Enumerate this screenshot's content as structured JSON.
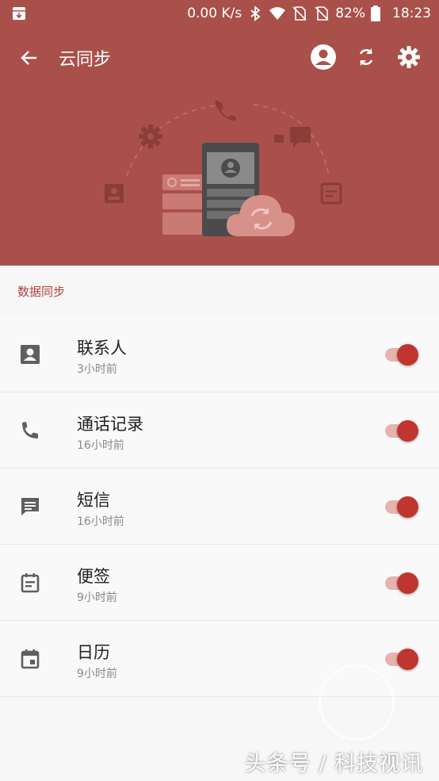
{
  "status_bar": {
    "network_speed": "0.00 K/s",
    "battery": "82%",
    "time": "18:23",
    "icons": [
      "download-icon",
      "bluetooth-icon",
      "wifi-icon",
      "sim-off-icon",
      "sim-off-icon",
      "battery-icon"
    ]
  },
  "toolbar": {
    "title": "云同步",
    "icons": [
      "back-arrow-icon",
      "account-icon",
      "sync-icon",
      "settings-icon"
    ]
  },
  "section": {
    "title": "数据同步"
  },
  "items": [
    {
      "label": "联系人",
      "sub": "3小时前",
      "icon": "contact-icon",
      "enabled": true
    },
    {
      "label": "通话记录",
      "sub": "16小时前",
      "icon": "phone-icon",
      "enabled": true
    },
    {
      "label": "短信",
      "sub": "16小时前",
      "icon": "message-icon",
      "enabled": true
    },
    {
      "label": "便签",
      "sub": "9小时前",
      "icon": "note-icon",
      "enabled": true
    },
    {
      "label": "日历",
      "sub": "9小时前",
      "icon": "calendar-icon",
      "enabled": true
    }
  ],
  "watermark": "头条号 / 科技视讯",
  "colors": {
    "header": "#a9504b",
    "accent": "#c0352f",
    "section_title": "#b2413b"
  }
}
